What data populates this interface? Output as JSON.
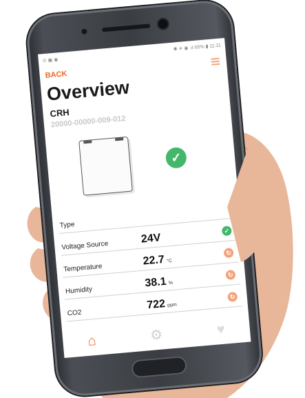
{
  "status_bar": {
    "left_icons": "⊙ ▣ ◉",
    "right_text": "✱ ✈ ◉ .ıl 65% ▮ 11:11"
  },
  "nav": {
    "back_label": "BACK"
  },
  "header": {
    "title": "Overview",
    "model": "CRH",
    "serial": "20000-00000-009-012"
  },
  "rows": [
    {
      "label": "Type",
      "value": "",
      "unit": "",
      "status": ""
    },
    {
      "label": "Voltage Source",
      "value": "24V",
      "unit": "",
      "status": "ok"
    },
    {
      "label": "Temperature",
      "value": "22.7",
      "unit": "°C",
      "status": "warn"
    },
    {
      "label": "Humidity",
      "value": "38.1",
      "unit": "%",
      "status": "warn"
    },
    {
      "label": "CO2",
      "value": "722",
      "unit": "ppm",
      "status": "warn"
    }
  ],
  "tabs": [
    {
      "icon": "home-icon",
      "active": true
    },
    {
      "icon": "gear-icon",
      "active": false
    },
    {
      "icon": "heart-pulse-icon",
      "active": false
    }
  ],
  "colors": {
    "accent": "#f26522",
    "ok": "#43b86b",
    "warn": "#f5a27a"
  }
}
